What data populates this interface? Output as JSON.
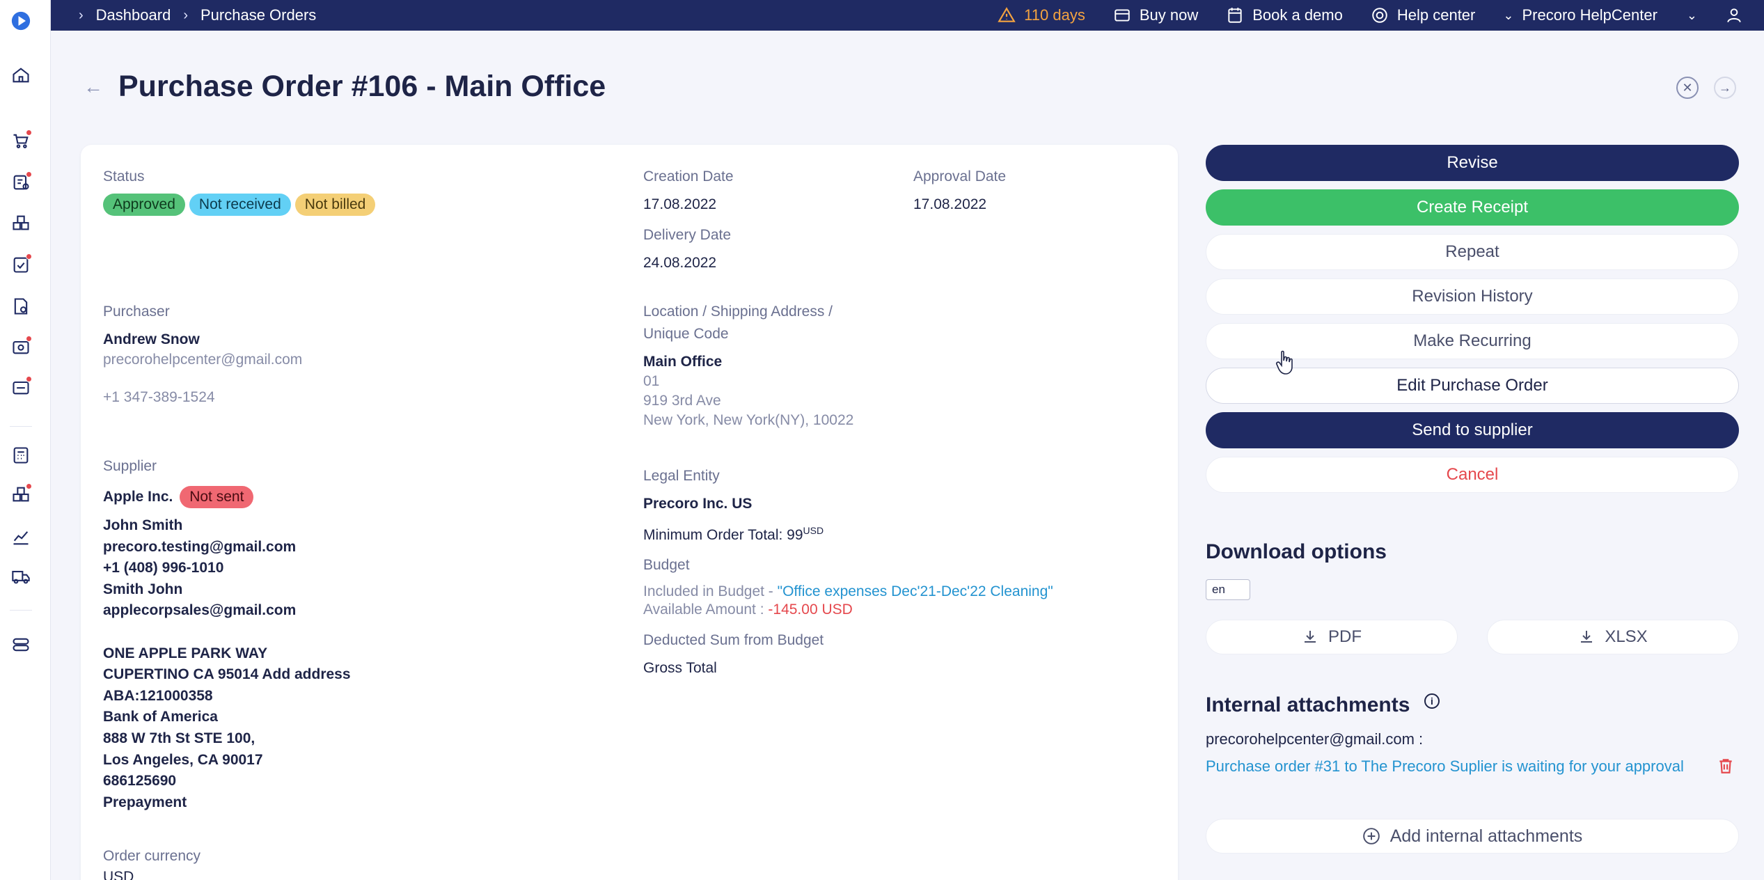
{
  "breadcrumb": [
    "Dashboard",
    "Purchase Orders"
  ],
  "topbar": {
    "trial": "110 days",
    "buy_now": "Buy now",
    "book_demo": "Book a demo",
    "help_center": "Help center",
    "account": "Precoro HelpCenter"
  },
  "page": {
    "title": "Purchase Order #106 - Main Office"
  },
  "details": {
    "status_label": "Status",
    "statuses": [
      "Approved",
      "Not received",
      "Not billed"
    ],
    "creation_date_label": "Creation Date",
    "creation_date": "17.08.2022",
    "approval_date_label": "Approval Date",
    "approval_date": "17.08.2022",
    "delivery_date_label": "Delivery Date",
    "delivery_date": "24.08.2022",
    "purchaser_label": "Purchaser",
    "purchaser_name": "Andrew Snow",
    "purchaser_email": "precorohelpcenter@gmail.com",
    "purchaser_phone": "+1 347-389-1524",
    "location_label_1": "Location / Shipping Address /",
    "location_label_2": "Unique Code",
    "location_name": "Main Office",
    "location_code": "01",
    "location_street": "919 3rd Ave",
    "location_city": "New York, New York(NY), 10022",
    "supplier_label": "Supplier",
    "supplier_name": "Apple Inc.",
    "supplier_badge": "Not sent",
    "supplier_lines": [
      "John Smith",
      "precoro.testing@gmail.com",
      "+1 (408) 996-1010",
      "Smith John",
      "applecorpsales@gmail.com",
      "",
      "ONE APPLE PARK WAY",
      "CUPERTINO CA 95014 Add address",
      "ABA:121000358",
      "Bank of America",
      "888 W 7th St STE 100,",
      "Los Angeles, CA 90017",
      "686125690",
      "Prepayment"
    ],
    "legal_entity_label": "Legal Entity",
    "legal_entity": "Precoro Inc. US",
    "min_order_label": "Minimum Order Total: 99",
    "min_order_currency": "USD",
    "budget_label": "Budget",
    "budget_included_prefix": "Included in Budget - ",
    "budget_name": "\"Office expenses Dec'21-Dec'22 Cleaning\"",
    "available_prefix": "Available Amount : ",
    "available_amount": "-145.00 USD",
    "deducted_label": "Deducted Sum from Budget",
    "deducted_value": "Gross Total",
    "currency_label": "Order currency",
    "currency_value": "USD"
  },
  "actions": {
    "revise": "Revise",
    "create_receipt": "Create Receipt",
    "repeat": "Repeat",
    "revision_history": "Revision History",
    "make_recurring": "Make Recurring",
    "edit": "Edit Purchase Order",
    "send": "Send to supplier",
    "cancel": "Cancel"
  },
  "downloads": {
    "title": "Download options",
    "language": "en",
    "pdf": "PDF",
    "xlsx": "XLSX"
  },
  "attachments": {
    "title": "Internal attachments",
    "email": "precorohelpcenter@gmail.com :",
    "file": "Purchase order #31 to The Precoro Suplier is waiting for your approval",
    "add": "Add internal attachments"
  },
  "colors": {
    "navy": "#1f2a63",
    "green": "#3cc068",
    "link": "#2393d0",
    "danger": "#e5484d",
    "warning": "#f4a340"
  }
}
